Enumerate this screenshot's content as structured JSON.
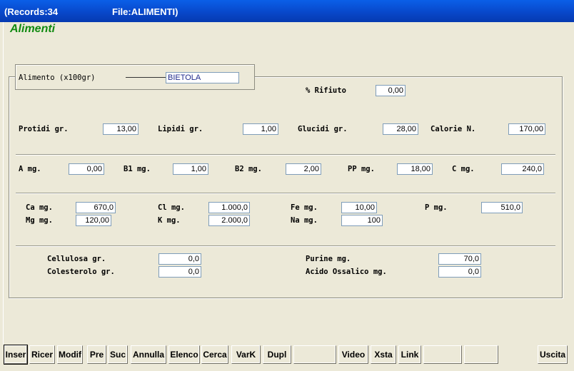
{
  "titlebar": {
    "records": "(Records:34",
    "file": "File:ALIMENTI)"
  },
  "app_title": "Alimenti",
  "alimento": {
    "label": "Alimento (x100gr)",
    "value": "BIETOLA"
  },
  "rifiuto": {
    "label": "% Rifiuto",
    "value": "0,00"
  },
  "row1": [
    {
      "label": "Protidi gr.",
      "value": "13,00"
    },
    {
      "label": "Lipidi  gr.",
      "value": "1,00"
    },
    {
      "label": "Glucidi gr.",
      "value": "28,00"
    },
    {
      "label": "Calorie N.",
      "value": "170,00"
    }
  ],
  "row2": [
    {
      "label": "A  mg.",
      "value": "0,00"
    },
    {
      "label": "B1 mg.",
      "value": "1,00"
    },
    {
      "label": "B2 mg.",
      "value": "2,00"
    },
    {
      "label": "PP mg.",
      "value": "18,00"
    },
    {
      "label": "C  mg.",
      "value": "240,0"
    }
  ],
  "minerals": [
    {
      "label": "Ca mg.",
      "value": "670,0"
    },
    {
      "label": "Cl mg.",
      "value": "1.000,0"
    },
    {
      "label": "Fe mg.",
      "value": "10,00"
    },
    {
      "label": "P  mg.",
      "value": "510,0"
    },
    {
      "label": "Mg mg.",
      "value": "120,00"
    },
    {
      "label": "K  mg.",
      "value": "2.000,0"
    },
    {
      "label": "Na mg.",
      "value": "100"
    }
  ],
  "others": [
    {
      "label": "Cellulosa gr.",
      "value": "0,0"
    },
    {
      "label": "Colesterolo gr.",
      "value": "0,0"
    },
    {
      "label": "Purine mg.",
      "value": "70,0"
    },
    {
      "label": "Acido Ossalico mg.",
      "value": "0,0"
    }
  ],
  "toolbar": {
    "inser": "Inser",
    "ricer": "Ricer",
    "modif": "Modif",
    "pre": "Pre",
    "suc": "Suc",
    "annulla": "Annulla",
    "elenco": "Elenco",
    "cerca": "Cerca",
    "vark": "VarK",
    "dupl": "Dupl",
    "video": "Video",
    "xsta": "Xsta",
    "link": "Link",
    "uscita": "Uscita"
  }
}
